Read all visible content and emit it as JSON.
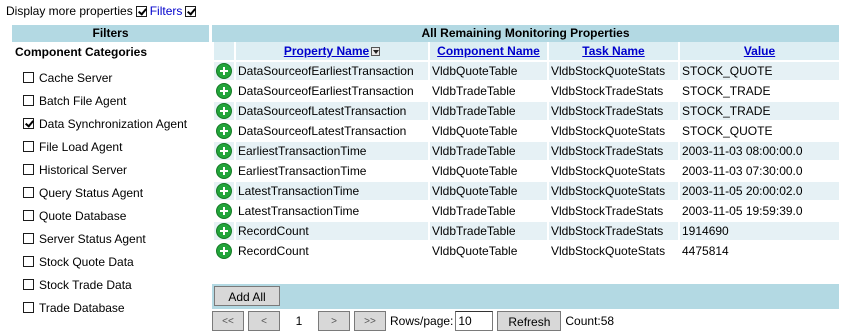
{
  "topbar": {
    "display_more_label": "Display more properties",
    "display_more_checked": true,
    "filters_link": "Filters",
    "filters_checked": true
  },
  "filters": {
    "header": "Filters",
    "subheader": "Component Categories",
    "categories": [
      {
        "label": "Cache Server",
        "checked": false
      },
      {
        "label": "Batch File Agent",
        "checked": false
      },
      {
        "label": "Data Synchronization Agent",
        "checked": true
      },
      {
        "label": "File Load Agent",
        "checked": false
      },
      {
        "label": "Historical Server",
        "checked": false
      },
      {
        "label": "Query Status Agent",
        "checked": false
      },
      {
        "label": "Quote Database",
        "checked": false
      },
      {
        "label": "Server Status Agent",
        "checked": false
      },
      {
        "label": "Stock Quote Data",
        "checked": false
      },
      {
        "label": "Stock Trade Data",
        "checked": false
      },
      {
        "label": "Trade Database",
        "checked": false
      }
    ]
  },
  "table": {
    "title": "All Remaining Monitoring Properties",
    "columns": [
      "Property Name",
      "Component Name",
      "Task Name",
      "Value"
    ],
    "rows": [
      [
        "DataSourceofEarliestTransaction",
        "VldbQuoteTable",
        "VldbStockQuoteStats",
        "STOCK_QUOTE"
      ],
      [
        "DataSourceofEarliestTransaction",
        "VldbTradeTable",
        "VldbStockTradeStats",
        "STOCK_TRADE"
      ],
      [
        "DataSourceofLatestTransaction",
        "VldbTradeTable",
        "VldbStockTradeStats",
        "STOCK_TRADE"
      ],
      [
        "DataSourceofLatestTransaction",
        "VldbQuoteTable",
        "VldbStockQuoteStats",
        "STOCK_QUOTE"
      ],
      [
        "EarliestTransactionTime",
        "VldbTradeTable",
        "VldbStockTradeStats",
        "2003-11-03 08:00:00.0"
      ],
      [
        "EarliestTransactionTime",
        "VldbQuoteTable",
        "VldbStockQuoteStats",
        "2003-11-03 07:30:00.0"
      ],
      [
        "LatestTransactionTime",
        "VldbQuoteTable",
        "VldbStockQuoteStats",
        "2003-11-05 20:00:02.0"
      ],
      [
        "LatestTransactionTime",
        "VldbTradeTable",
        "VldbStockTradeStats",
        "2003-11-05 19:59:39.0"
      ],
      [
        "RecordCount",
        "VldbTradeTable",
        "VldbStockTradeStats",
        "1914690"
      ],
      [
        "RecordCount",
        "VldbQuoteTable",
        "VldbStockQuoteStats",
        "4475814"
      ]
    ],
    "add_all_label": "Add All"
  },
  "pager": {
    "first": "<<",
    "prev": "<",
    "page": "1",
    "next": ">",
    "last": ">>",
    "rows_per_page_label": "Rows/page:",
    "rows_per_page_value": "10",
    "refresh_label": "Refresh",
    "count_label": "Count:58"
  }
}
